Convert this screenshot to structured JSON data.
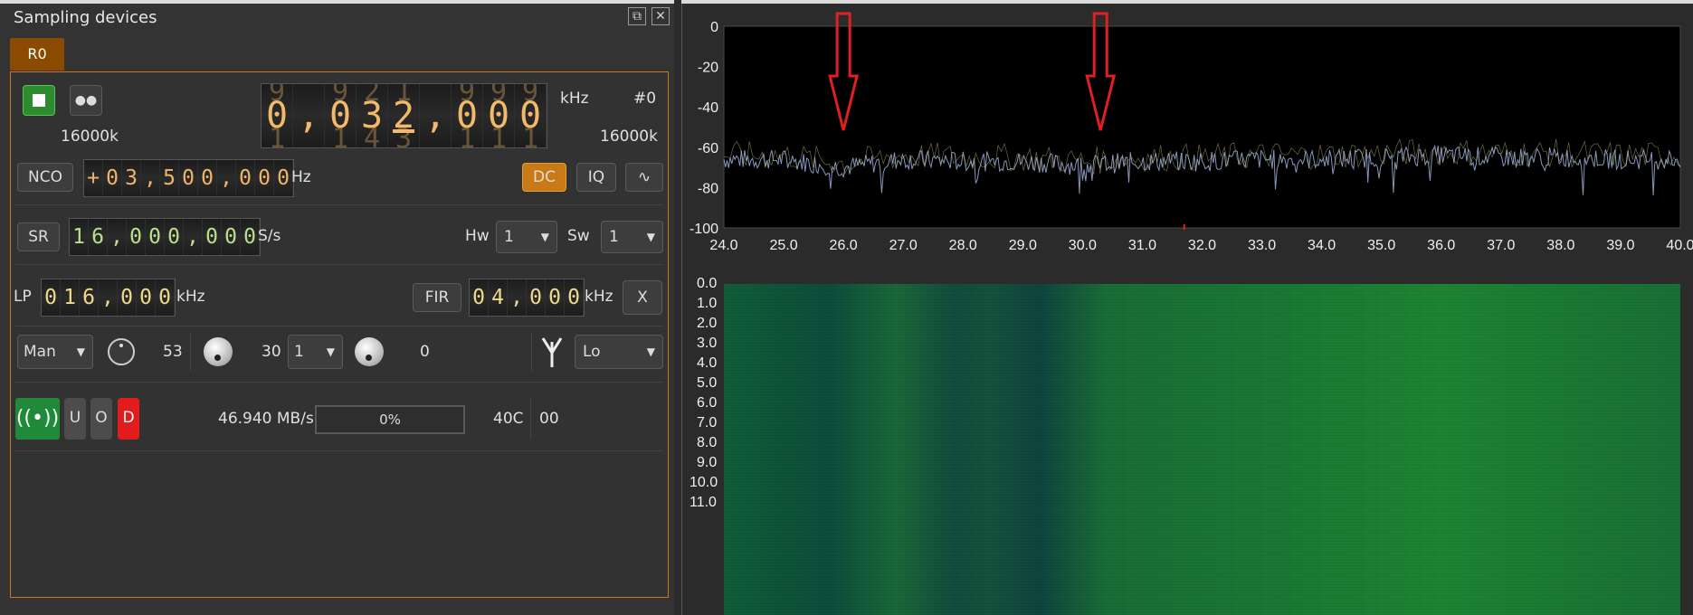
{
  "panel": {
    "title": "Sampling devices",
    "tab": "R0"
  },
  "center_freq": {
    "digits": [
      {
        "char": "0",
        "ghost_top": "9",
        "ghost_bot": "1"
      },
      {
        "char": ",",
        "ghost_top": "",
        "ghost_bot": ""
      },
      {
        "char": "0",
        "ghost_top": "9",
        "ghost_bot": "1"
      },
      {
        "char": "3",
        "ghost_top": "2",
        "ghost_bot": "4"
      },
      {
        "char": "2",
        "ghost_top": "1",
        "ghost_bot": "3"
      },
      {
        "char": ",",
        "ghost_top": "",
        "ghost_bot": ""
      },
      {
        "char": "0",
        "ghost_top": "9",
        "ghost_bot": "1"
      },
      {
        "char": "0",
        "ghost_top": "9",
        "ghost_bot": "1"
      },
      {
        "char": "0",
        "ghost_top": "9",
        "ghost_bot": "1"
      }
    ],
    "unit": "kHz",
    "device_index": "#0",
    "sample_rate_left": "16000k",
    "sample_rate_right": "16000k"
  },
  "nco": {
    "label": "NCO",
    "digits": [
      {
        "char": "+",
        "ghost_top": "",
        "ghost_bot": "",
        "ghost": false
      },
      {
        "char": "0",
        "ghost_top": "",
        "ghost_bot": "",
        "ghost": true
      },
      {
        "char": "3",
        "ghost_top": "",
        "ghost_bot": "",
        "ghost": true
      },
      {
        "char": ",",
        "ghost_top": "",
        "ghost_bot": "",
        "ghost": false
      },
      {
        "char": "5",
        "ghost_top": "",
        "ghost_bot": "",
        "ghost": true
      },
      {
        "char": "0",
        "ghost_top": "",
        "ghost_bot": "",
        "ghost": true
      },
      {
        "char": "0",
        "ghost_top": "",
        "ghost_bot": "",
        "ghost": true
      },
      {
        "char": ",",
        "ghost_top": "",
        "ghost_bot": "",
        "ghost": false
      },
      {
        "char": "0",
        "ghost_top": "",
        "ghost_bot": "",
        "ghost": true
      },
      {
        "char": "0",
        "ghost_top": "",
        "ghost_bot": "",
        "ghost": true
      },
      {
        "char": "0",
        "ghost_top": "",
        "ghost_bot": "",
        "ghost": true
      }
    ],
    "unit": "Hz",
    "dc_label": "DC",
    "iq_label": "IQ"
  },
  "sr": {
    "label": "SR",
    "digits": [
      "1",
      "6",
      ",",
      "0",
      "0",
      "0",
      ",",
      "0",
      "0",
      "0"
    ],
    "unit": "S/s",
    "hw_label": "Hw",
    "hw_value": "1",
    "sw_label": "Sw",
    "sw_value": "1"
  },
  "lp": {
    "label": "LP",
    "digits": [
      "0",
      "1",
      "6",
      ",",
      "0",
      "0",
      "0"
    ],
    "unit": "kHz",
    "fir_label": "FIR",
    "fir_digits": [
      "0",
      "4",
      ",",
      "0",
      "0",
      "0"
    ],
    "fir_unit": "kHz",
    "x_label": "X"
  },
  "gain": {
    "mode": "Man",
    "gain1": "53",
    "gain2": "30",
    "gain2_select": "1",
    "gain3": "0",
    "antenna": "Lo"
  },
  "status": {
    "u_label": "U",
    "o_label": "O",
    "d_label": "D",
    "throughput": "46.940 MB/s",
    "buffer_percent": "0%",
    "buffer_fraction": 0,
    "temperature": "40C",
    "misc": "00"
  },
  "chart_data": [
    {
      "type": "line",
      "title": "",
      "xlabel": "",
      "ylabel": "",
      "x_ticks": [
        "24.0",
        "25.0",
        "26.0",
        "27.0",
        "28.0",
        "29.0",
        "30.0",
        "31.0",
        "32.0",
        "33.0",
        "34.0",
        "35.0",
        "36.0",
        "37.0",
        "38.0",
        "39.0",
        "40.0"
      ],
      "y_ticks": [
        "0",
        "-20",
        "-40",
        "-60",
        "-80",
        "-100"
      ],
      "xlim": [
        24.0,
        40.0
      ],
      "ylim": [
        -100,
        0
      ],
      "series": [
        {
          "x": [
            24.0,
            25.0,
            26.0,
            27.0,
            28.0,
            29.0,
            30.0,
            31.0,
            32.0,
            33.0,
            34.0,
            35.0,
            36.0,
            37.0,
            38.0,
            39.0,
            40.0
          ],
          "values": [
            -66,
            -66,
            -70,
            -66,
            -67,
            -67,
            -69,
            -67,
            -67,
            -66,
            -66,
            -65,
            -64,
            -65,
            -65,
            -66,
            -66
          ]
        }
      ],
      "annotations": [
        {
          "type": "arrow-down",
          "x": 26.0,
          "color": "#e02020"
        },
        {
          "type": "arrow-down",
          "x": 30.3,
          "color": "#e02020"
        }
      ]
    },
    {
      "type": "heatmap",
      "y_ticks": [
        "0.0",
        "1.0",
        "2.0",
        "3.0",
        "4.0",
        "5.0",
        "6.0",
        "7.0",
        "8.0",
        "9.0",
        "10.0",
        "11.0"
      ]
    }
  ]
}
